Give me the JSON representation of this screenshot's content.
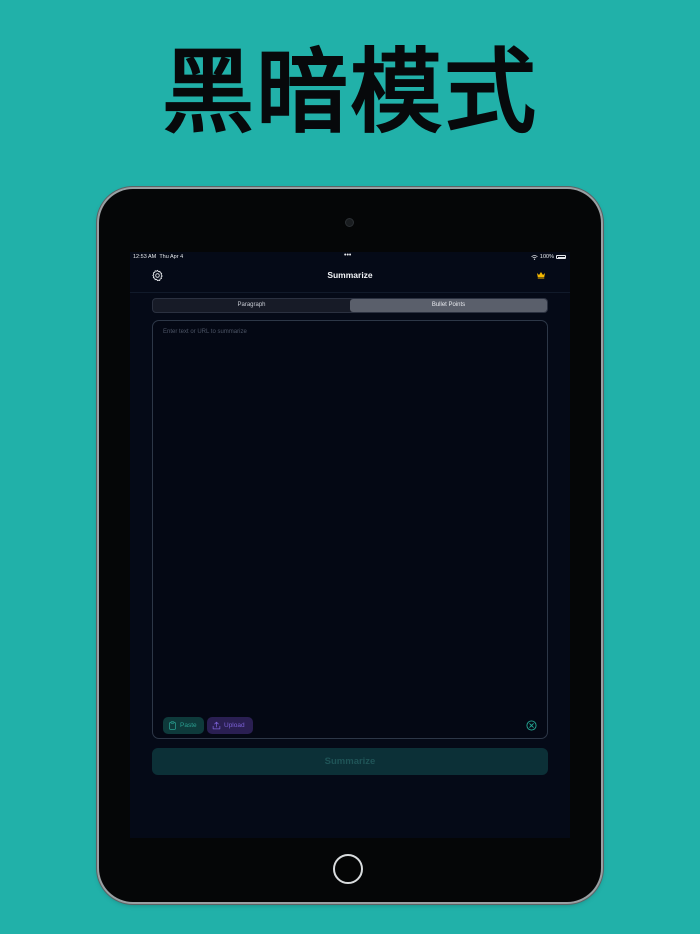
{
  "headline": "黑暗模式",
  "status_bar": {
    "time": "12:53 AM",
    "date": "Thu Apr 4",
    "dots": "•••",
    "battery": "100%"
  },
  "nav": {
    "title": "Summarize",
    "settings_icon": "gear-icon",
    "premium_icon": "crown-icon"
  },
  "segments": {
    "items": [
      "Paragraph",
      "Bullet Points"
    ],
    "selected": "Bullet Points"
  },
  "editor": {
    "placeholder": "Enter text or URL to summarize",
    "value": ""
  },
  "actions": {
    "paste_label": "Paste",
    "upload_label": "Upload"
  },
  "summarize_label": "Summarize",
  "colors": {
    "background": "#21b1a9",
    "screen": "#050a17",
    "accent_teal": "#2a9f91",
    "accent_purple": "#7b61d6",
    "crown": "#f5b800"
  }
}
